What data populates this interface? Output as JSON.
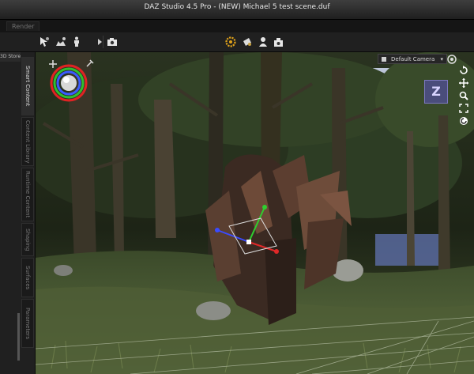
{
  "window": {
    "title": "DAZ Studio 4.5 Pro - (NEW) Michael 5 test scene.duf"
  },
  "tabs": [
    {
      "label": "Render"
    }
  ],
  "toolbar": {
    "left_tools": [
      "node-selection-icon",
      "universal-tool-icon",
      "figure-posing-icon",
      "play-arrow-icon",
      "camera-icon"
    ],
    "center_tools": [
      "render-settings-icon",
      "render-icon",
      "spot-render-icon",
      "render-to-new-window-icon"
    ]
  },
  "left_panel": {
    "store_label": "3D Store",
    "tabs": [
      "Smart Content",
      "Content Library",
      "Runtime Content",
      "Shaping",
      "Surfaces",
      "Parameters"
    ],
    "active_tab": "Smart Content"
  },
  "viewport": {
    "camera_select": "Default Camera",
    "view_cube_label": "Z",
    "nav_controls": [
      "rotate-icon",
      "pan-icon",
      "zoom-icon",
      "frame-icon",
      "reset-icon"
    ]
  }
}
